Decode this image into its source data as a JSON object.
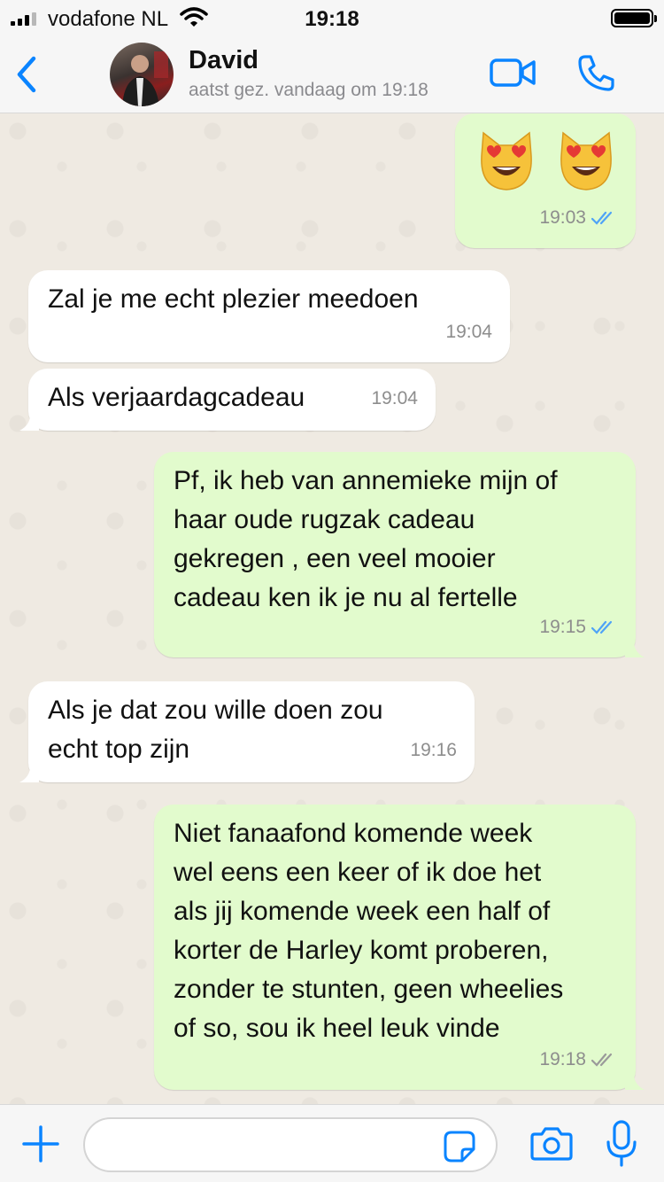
{
  "status_bar": {
    "carrier": "vodafone NL",
    "time": "19:18"
  },
  "header": {
    "contact_name": "David",
    "last_seen": "aatst gez. vandaag om 19:18"
  },
  "messages": [
    {
      "direction": "out",
      "text": "😻 😻",
      "time": "19:03",
      "read_status": "read"
    },
    {
      "direction": "in",
      "text": "Zal je me echt plezier meedoen",
      "time": "19:04"
    },
    {
      "direction": "in",
      "text": "Als verjaardagcadeau",
      "time": "19:04"
    },
    {
      "direction": "out",
      "text": "Pf, ik heb van annemieke mijn of\nhaar oude rugzak cadeau\ngekregen , een veel mooier\ncadeau ken ik je nu al fertelle",
      "time": "19:15",
      "read_status": "read"
    },
    {
      "direction": "in",
      "text": "Als je dat zou wille doen zou\necht top zijn",
      "time": "19:16"
    },
    {
      "direction": "out",
      "text": "Niet fanaafond komende week\nwel eens een keer of ik doe het\nals jij komende week een half of\nkorter de Harley komt proberen,\nzonder te stunten, geen wheelies\nof so, sou ik heel leuk vinde",
      "time": "19:18",
      "read_status": "delivered"
    }
  ],
  "input": {
    "value": "",
    "placeholder": ""
  },
  "colors": {
    "accent": "#0a84ff",
    "outgoing_bubble": "#e2fbcd",
    "incoming_bubble": "#ffffff",
    "read_ticks": "#4fa3f7",
    "delivered_ticks": "#9a9a9a"
  },
  "icons": {
    "back": "chevron-left-icon",
    "video": "video-camera-icon",
    "call": "phone-icon",
    "plus": "plus-icon",
    "sticker": "sticker-icon",
    "camera": "camera-icon",
    "mic": "microphone-icon"
  }
}
